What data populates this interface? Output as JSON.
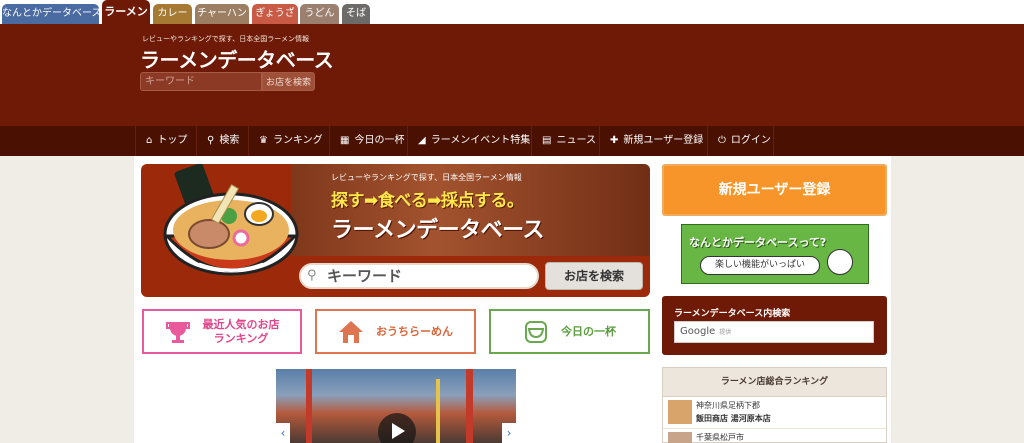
{
  "site_tabs": [
    {
      "label": "なんとかデータベース",
      "color": "#4a6aa2"
    },
    {
      "label": "ラーメン",
      "color": "#6f1a07",
      "active": true
    },
    {
      "label": "カレー",
      "color": "#a67a33"
    },
    {
      "label": "チャーハン",
      "color": "#9c7f63"
    },
    {
      "label": "ぎょうざ",
      "color": "#c85a46"
    },
    {
      "label": "うどん",
      "color": "#9b7f6f"
    },
    {
      "label": "そば",
      "color": "#6d6a6a"
    }
  ],
  "header": {
    "tagline": "レビューやランキングで探す、日本全国ラーメン情報",
    "logo": "ラーメンデータベース",
    "search_placeholder": "キーワード",
    "search_button": "お店を検索"
  },
  "nav": [
    {
      "label": "トップ",
      "icon": "home-icon",
      "glyph": "⌂"
    },
    {
      "label": "検索",
      "icon": "search-icon",
      "glyph": "⚲"
    },
    {
      "label": "ランキング",
      "icon": "trophy-icon",
      "glyph": "♛"
    },
    {
      "label": "今日の一杯",
      "icon": "calendar-icon",
      "glyph": "▦"
    },
    {
      "label": "ラーメンイベント特集",
      "icon": "megaphone-icon",
      "glyph": "◢"
    },
    {
      "label": "ニュース",
      "icon": "news-icon",
      "glyph": "▤"
    },
    {
      "label": "新規ユーザー登録",
      "icon": "user-plus-icon",
      "glyph": "✚"
    },
    {
      "label": "ログイン",
      "icon": "power-icon",
      "glyph": "⏻"
    }
  ],
  "hero": {
    "tagline": "レビューやランキングで探す、日本全国ラーメン情報",
    "slogan": "探す➡食べる➡採点する。",
    "title": "ラーメンデータベース",
    "search_placeholder": "キーワード",
    "search_button": "お店を検索"
  },
  "categories": {
    "ranking": "最近人気のお店\nランキング",
    "ranking_l1": "最近人気のお店",
    "ranking_l2": "ランキング",
    "home": "おうちらーめん",
    "today": "今日の一杯"
  },
  "sidebar": {
    "signup": "新規ユーザー登録",
    "nantoka_title": "なんとかデータベースって?",
    "nantoka_sub": "楽しい機能がいっぱい",
    "search_title": "ラーメンデータベース内検索",
    "google_label": "Google",
    "google_sub": "提供",
    "ranking_title": "ラーメン店総合ランキング",
    "ranking_rows": [
      {
        "pref": "神奈川県足柄下郡",
        "name": "飯田商店 湯河原本店"
      },
      {
        "pref": "千葉県松戸市",
        "name": ""
      }
    ]
  },
  "colors": {
    "brand": "#6f1a07",
    "nav": "#4a1103",
    "signup": "#f7952a",
    "ranking_pink": "#e85a9b",
    "home_orange": "#dd7650",
    "today_green": "#6aa84f"
  }
}
